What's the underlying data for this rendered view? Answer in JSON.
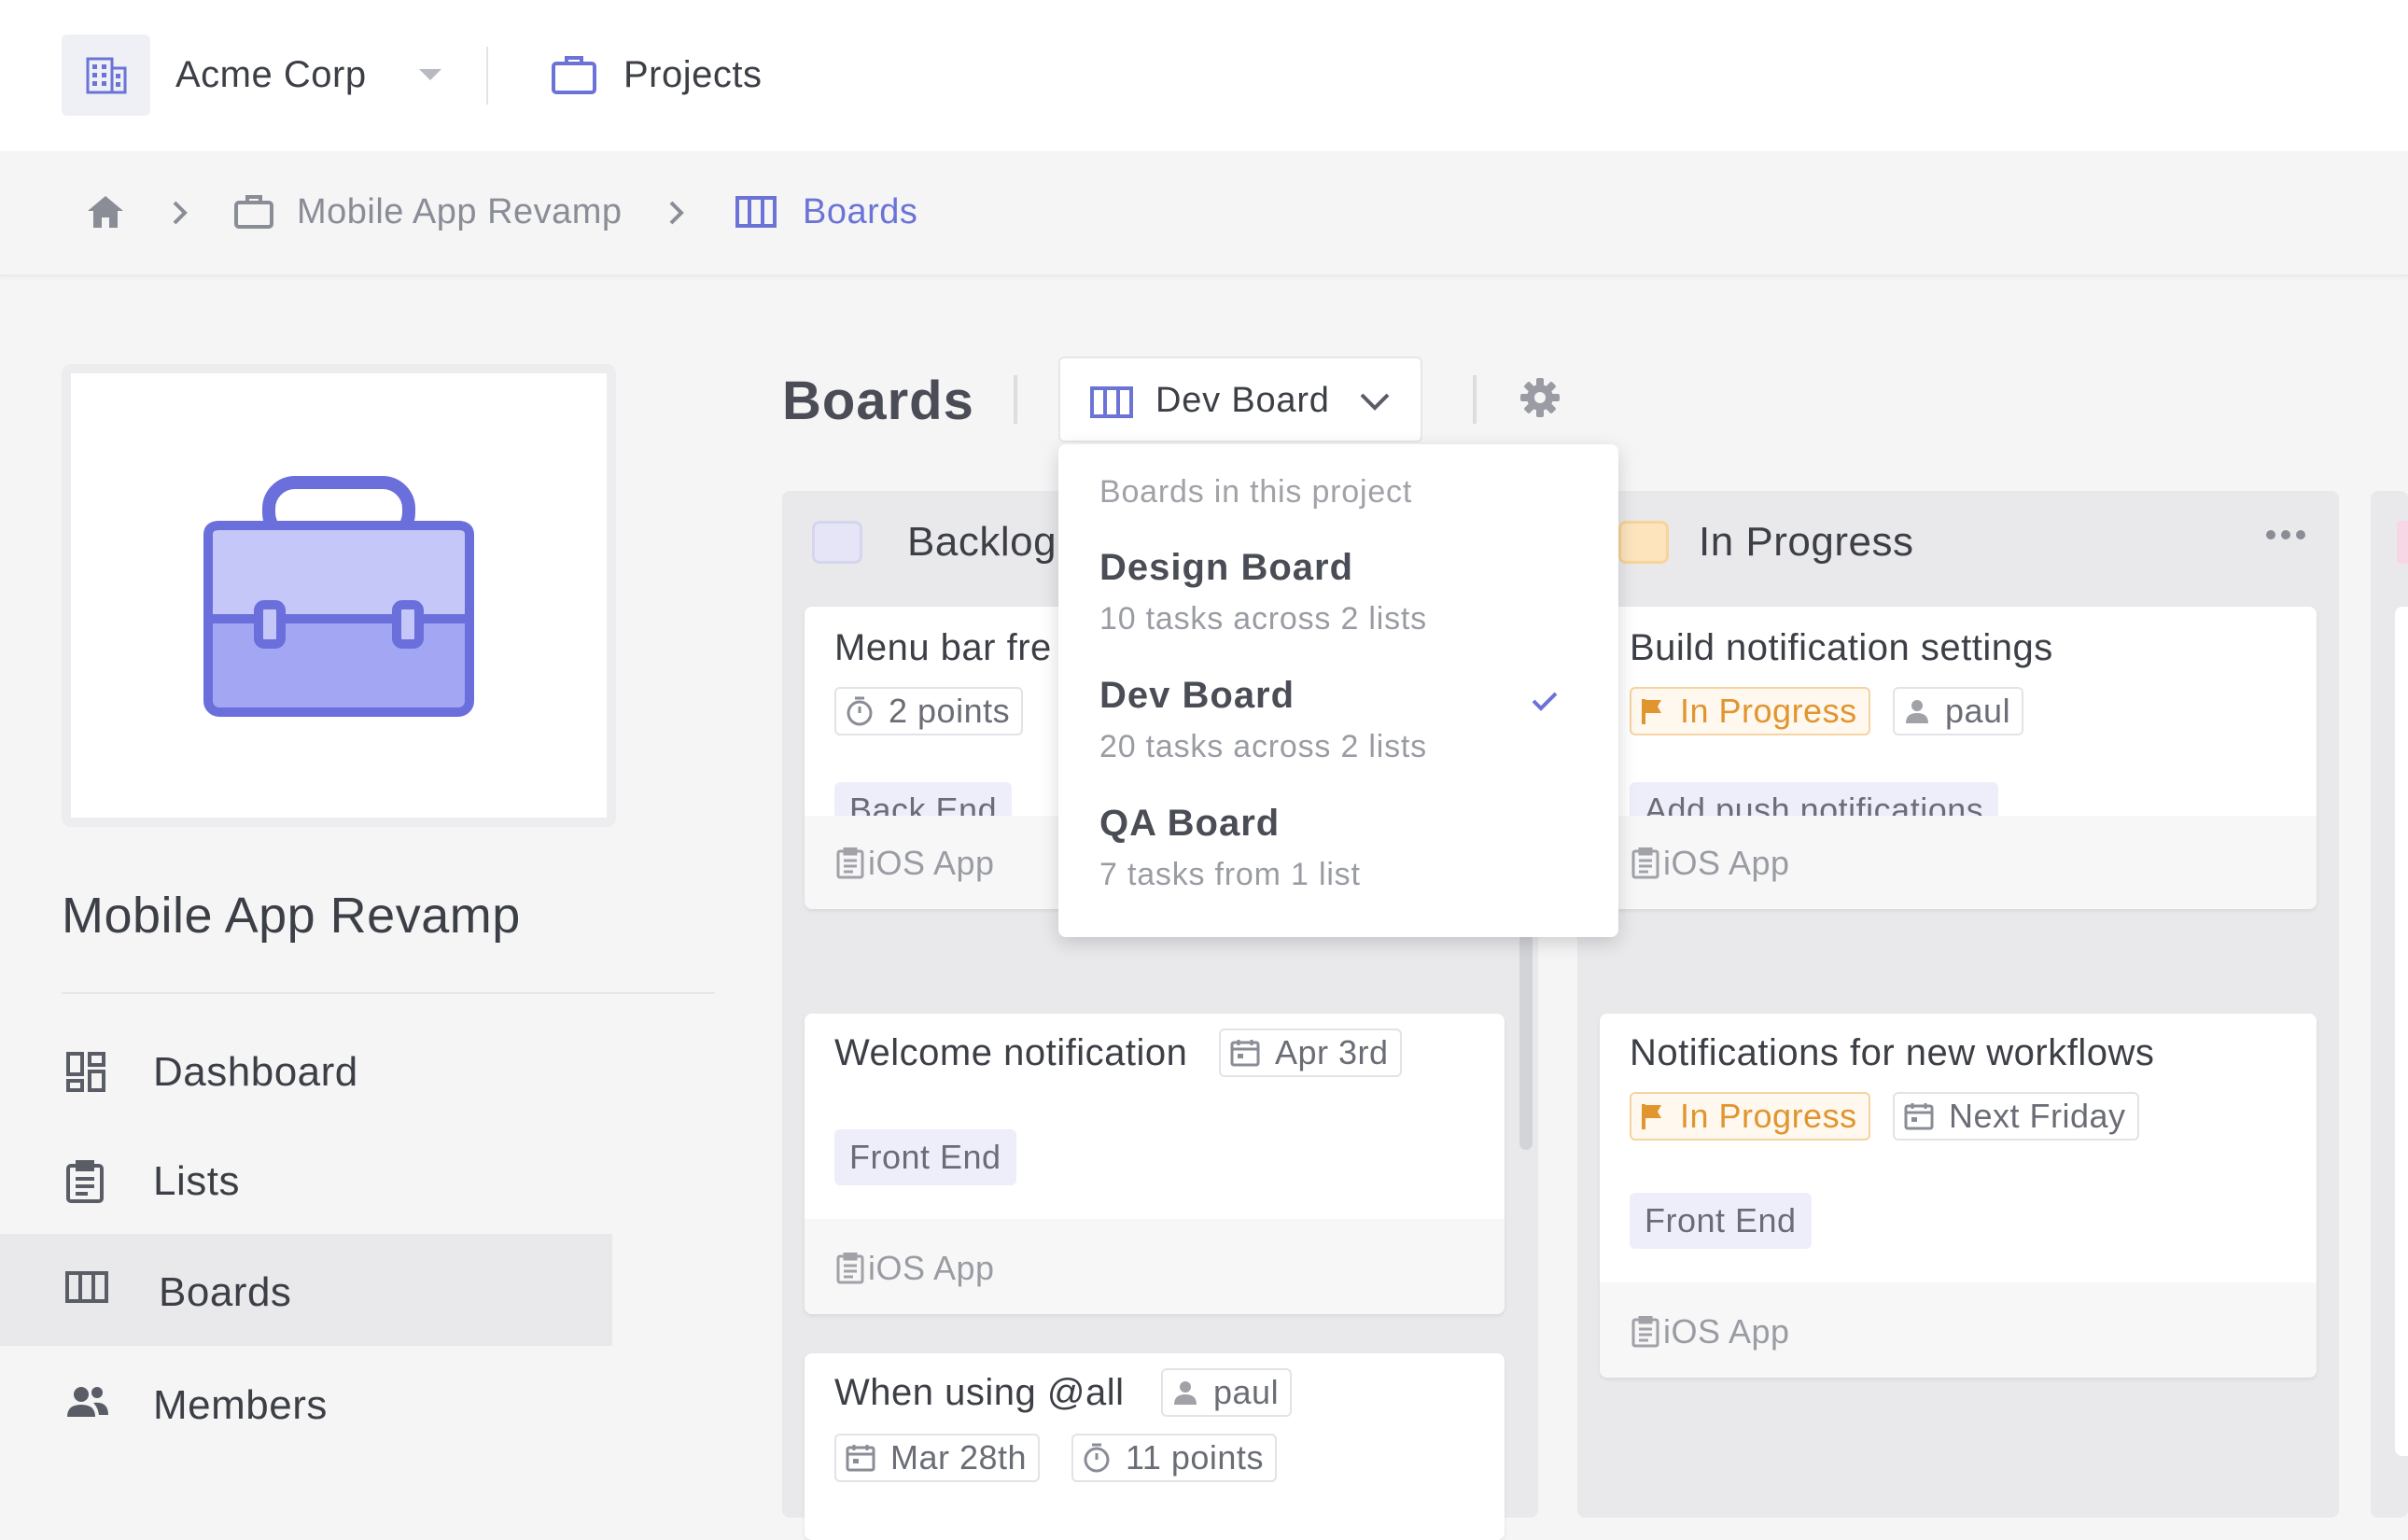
{
  "topbar": {
    "org_name": "Acme Corp",
    "org_icon": "building-icon",
    "projects_label": "Projects",
    "projects_icon": "briefcase-icon"
  },
  "breadcrumb": {
    "items": [
      {
        "icon": "home-icon"
      },
      {
        "label": "Mobile App Revamp",
        "icon": "briefcase-icon"
      },
      {
        "label": "Boards",
        "icon": "board-icon"
      }
    ]
  },
  "sidebar": {
    "project_title": "Mobile App Revamp",
    "nav": [
      {
        "label": "Dashboard",
        "icon": "dashboard-icon"
      },
      {
        "label": "Lists",
        "icon": "clipboard-icon"
      },
      {
        "label": "Boards",
        "icon": "board-icon",
        "active": true
      },
      {
        "label": "Members",
        "icon": "members-icon"
      }
    ]
  },
  "header": {
    "title": "Boards",
    "selected_board": "Dev Board"
  },
  "dropdown": {
    "header": "Boards in this project",
    "items": [
      {
        "name": "Design Board",
        "sub": "10 tasks across 2 lists",
        "selected": false
      },
      {
        "name": "Dev Board",
        "sub": "20 tasks across 2 lists",
        "selected": true
      },
      {
        "name": "QA Board",
        "sub": "7 tasks from 1 list",
        "selected": false
      }
    ]
  },
  "columns": [
    {
      "title": "Backlog",
      "swatch_color": "#e5e5f7",
      "cards": [
        {
          "title": "Menu bar fre",
          "pills": [
            {
              "icon": "timer-icon",
              "text": "2 points"
            }
          ],
          "tag": "Back End",
          "list": "iOS App"
        },
        {
          "title": "Welcome notification",
          "pills": [
            {
              "icon": "calendar-icon",
              "text": "Apr 3rd"
            }
          ],
          "tag": "Front End",
          "list": "iOS App"
        },
        {
          "title": "When using @all",
          "pills": [
            {
              "icon": "user-icon",
              "text": "paul"
            },
            {
              "icon": "calendar-icon",
              "text": "Mar 28th"
            },
            {
              "icon": "timer-icon",
              "text": "11 points"
            }
          ]
        }
      ]
    },
    {
      "title": "In Progress",
      "swatch_color": "#fde4bd",
      "cards": [
        {
          "title": "Build notification settings",
          "pills": [
            {
              "icon": "flag-icon",
              "text": "In Progress"
            },
            {
              "icon": "user-icon",
              "text": "paul"
            }
          ],
          "tag": "Add push notifications",
          "list": "iOS App"
        },
        {
          "title": "Notifications for new workflows",
          "pills": [
            {
              "icon": "flag-icon",
              "text": "In Progress"
            },
            {
              "icon": "calendar-icon",
              "text": "Next Friday"
            }
          ],
          "tag": "Front End",
          "list": "iOS App"
        }
      ]
    }
  ],
  "colors": {
    "accent": "#6b74d6",
    "status_orange": "#e0952f",
    "tag_bg": "#eeeefb"
  }
}
